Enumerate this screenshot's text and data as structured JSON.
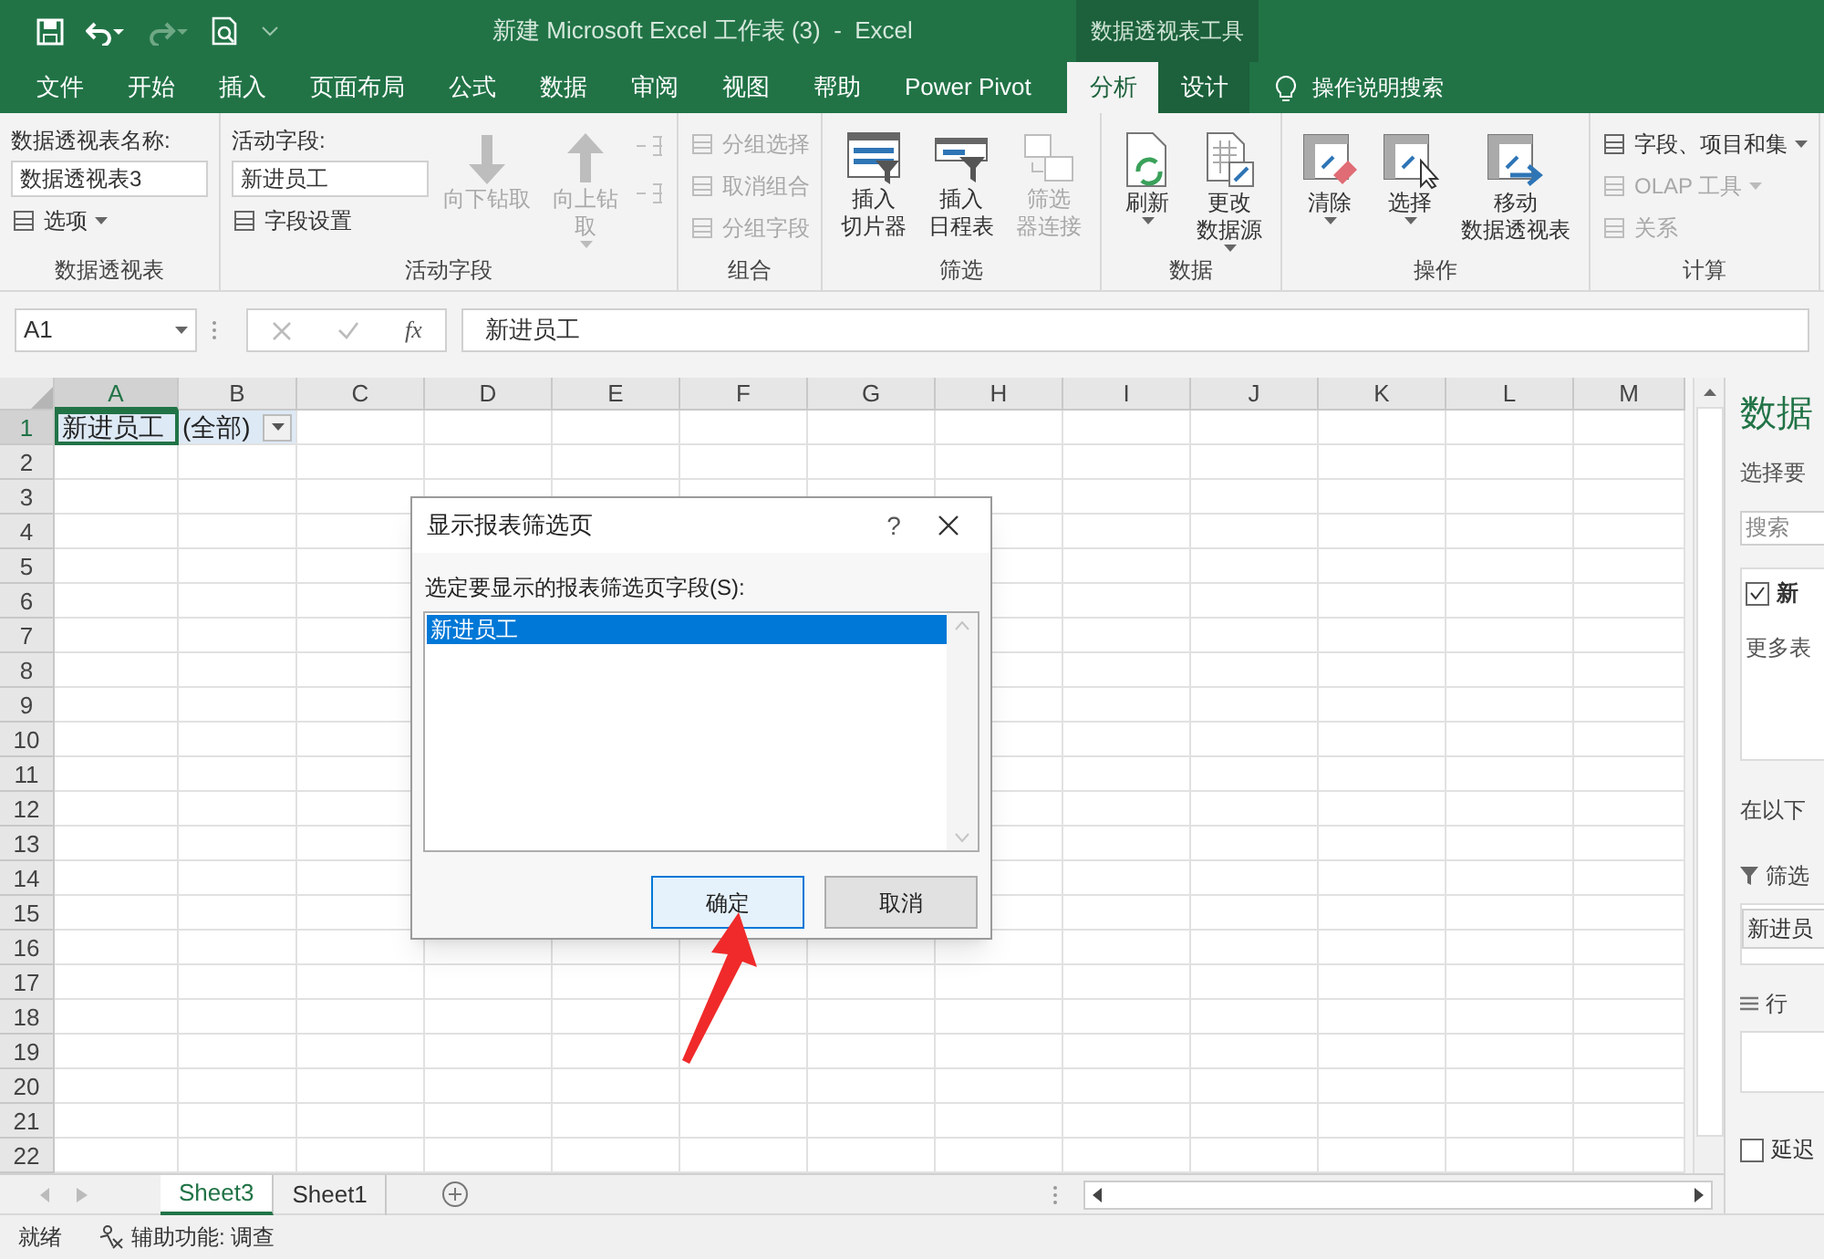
{
  "window": {
    "title": "新建 Microsoft Excel 工作表 (3)  -  Excel",
    "context_group": "数据透视表工具"
  },
  "quick_access": [
    {
      "disabled": false
    },
    {
      "disabled": false
    },
    {
      "disabled": true
    },
    {
      "disabled": false
    }
  ],
  "tabs": [
    {
      "label": "文件",
      "selected": false,
      "contextual": false
    },
    {
      "label": "开始",
      "selected": false,
      "contextual": false
    },
    {
      "label": "插入",
      "selected": false,
      "contextual": false
    },
    {
      "label": "页面布局",
      "selected": false,
      "contextual": false
    },
    {
      "label": "公式",
      "selected": false,
      "contextual": false
    },
    {
      "label": "数据",
      "selected": false,
      "contextual": false
    },
    {
      "label": "审阅",
      "selected": false,
      "contextual": false
    },
    {
      "label": "视图",
      "selected": false,
      "contextual": false
    },
    {
      "label": "帮助",
      "selected": false,
      "contextual": false
    },
    {
      "label": "Power Pivot",
      "selected": false,
      "contextual": false
    },
    {
      "label": "分析",
      "selected": true,
      "contextual": true
    },
    {
      "label": "设计",
      "selected": false,
      "contextual": true
    }
  ],
  "tell_me": "操作说明搜索",
  "ribbon": [
    {
      "label": "数据透视表",
      "columns": [
        [
          {
            "kind": "label",
            "text": "数据透视表名称:"
          },
          {
            "kind": "field",
            "text": "数据透视表3"
          },
          {
            "kind": "small",
            "text": "选项",
            "dropdown": true,
            "disabled": false
          }
        ]
      ]
    },
    {
      "label": "活动字段",
      "columns": [
        [
          {
            "kind": "label",
            "text": "活动字段:"
          },
          {
            "kind": "field",
            "text": "新进员工"
          },
          {
            "kind": "small",
            "text": "字段设置",
            "dropdown": false,
            "disabled": false
          }
        ],
        [
          {
            "kind": "large",
            "lines": [
              "向下钻取"
            ],
            "dropdown": false,
            "disabled": true
          }
        ],
        [
          {
            "kind": "large",
            "lines": [
              "向上钻",
              "取"
            ],
            "dropdown": true,
            "disabled": true
          }
        ],
        [
          {
            "kind": "icon",
            "disabled": true
          },
          {
            "kind": "icon",
            "disabled": true
          }
        ]
      ]
    },
    {
      "label": "组合",
      "columns": [
        [
          {
            "kind": "small",
            "text": "分组选择",
            "dropdown": false,
            "disabled": true
          },
          {
            "kind": "small",
            "text": "取消组合",
            "dropdown": false,
            "disabled": true
          },
          {
            "kind": "small",
            "text": "分组字段",
            "dropdown": false,
            "disabled": true
          }
        ]
      ]
    },
    {
      "label": "筛选",
      "columns": [
        [
          {
            "kind": "large",
            "lines": [
              "插入",
              "切片器"
            ],
            "dropdown": false,
            "disabled": false
          }
        ],
        [
          {
            "kind": "large",
            "lines": [
              "插入",
              "日程表"
            ],
            "dropdown": false,
            "disabled": false
          }
        ],
        [
          {
            "kind": "large",
            "lines": [
              "筛选",
              "器连接"
            ],
            "dropdown": false,
            "disabled": true
          }
        ]
      ]
    },
    {
      "label": "数据",
      "columns": [
        [
          {
            "kind": "large",
            "lines": [
              "刷新"
            ],
            "dropdown": true,
            "disabled": false
          }
        ],
        [
          {
            "kind": "large",
            "lines": [
              "更改",
              "数据源"
            ],
            "dropdown": true,
            "disabled": false
          }
        ]
      ]
    },
    {
      "label": "操作",
      "columns": [
        [
          {
            "kind": "large",
            "lines": [
              "清除"
            ],
            "dropdown": true,
            "disabled": false
          }
        ],
        [
          {
            "kind": "large",
            "lines": [
              "选择"
            ],
            "dropdown": true,
            "disabled": false
          }
        ],
        [
          {
            "kind": "large",
            "lines": [
              "移动",
              "数据透视表"
            ],
            "dropdown": false,
            "disabled": false
          }
        ]
      ]
    },
    {
      "label": "计算",
      "columns": [
        [
          {
            "kind": "small",
            "text": "字段、项目和集",
            "dropdown": true,
            "disabled": false
          },
          {
            "kind": "small",
            "text": "OLAP 工具",
            "dropdown": true,
            "disabled": true
          },
          {
            "kind": "small",
            "text": "关系",
            "dropdown": false,
            "disabled": true
          }
        ]
      ]
    }
  ],
  "formula_bar": {
    "name_box": "A1",
    "fx": "fx",
    "content": "新进员工"
  },
  "sheet": {
    "columns": [
      {
        "label": "A",
        "selected": true
      },
      {
        "label": "B",
        "selected": false
      },
      {
        "label": "C",
        "selected": false
      },
      {
        "label": "D",
        "selected": false
      },
      {
        "label": "E",
        "selected": false
      },
      {
        "label": "F",
        "selected": false
      },
      {
        "label": "G",
        "selected": false
      },
      {
        "label": "H",
        "selected": false
      },
      {
        "label": "I",
        "selected": false
      },
      {
        "label": "J",
        "selected": false
      },
      {
        "label": "K",
        "selected": false
      },
      {
        "label": "L",
        "selected": false
      },
      {
        "label": "M",
        "selected": false
      }
    ],
    "rows": [
      {
        "label": "1",
        "selected": true,
        "cells": [
          {
            "text": "新进员工",
            "selected": true,
            "dropdown": false
          },
          {
            "text": "(全部)",
            "selected": false,
            "dropdown": true
          }
        ]
      },
      {
        "label": "2",
        "selected": false
      },
      {
        "label": "3",
        "selected": false
      },
      {
        "label": "4",
        "selected": false
      },
      {
        "label": "5",
        "selected": false
      },
      {
        "label": "6",
        "selected": false
      },
      {
        "label": "7",
        "selected": false
      },
      {
        "label": "8",
        "selected": false
      },
      {
        "label": "9",
        "selected": false
      },
      {
        "label": "10",
        "selected": false
      },
      {
        "label": "11",
        "selected": false
      },
      {
        "label": "12",
        "selected": false
      },
      {
        "label": "13",
        "selected": false
      },
      {
        "label": "14",
        "selected": false
      },
      {
        "label": "15",
        "selected": false
      },
      {
        "label": "16",
        "selected": false
      },
      {
        "label": "17",
        "selected": false
      },
      {
        "label": "18",
        "selected": false
      },
      {
        "label": "19",
        "selected": false
      },
      {
        "label": "20",
        "selected": false
      },
      {
        "label": "21",
        "selected": false
      },
      {
        "label": "22",
        "selected": false
      }
    ]
  },
  "dialog": {
    "title": "显示报表筛选页",
    "help": "?",
    "prompt": "选定要显示的报表筛选页字段(S):",
    "items": [
      {
        "text": "新进员工",
        "selected": true
      }
    ],
    "buttons": [
      {
        "label": "确定",
        "default": true
      },
      {
        "label": "取消",
        "default": false
      }
    ]
  },
  "sheet_tabs": [
    {
      "label": "Sheet3",
      "selected": true
    },
    {
      "label": "Sheet1",
      "selected": false
    }
  ],
  "field_pane": {
    "title": "数据",
    "subtitle": "选择要",
    "search_placeholder": "搜索",
    "fields": [
      {
        "label": "新",
        "checked": true
      }
    ],
    "more_tables": "更多表",
    "areas_label": "在以下",
    "filters_label": "筛选",
    "filter_items": [
      "新进员"
    ],
    "rows_label": "行",
    "defer": {
      "label": "延迟",
      "checked": false
    }
  },
  "status_bar": {
    "status": "就绪",
    "accessibility": "辅助功能: 调查"
  }
}
